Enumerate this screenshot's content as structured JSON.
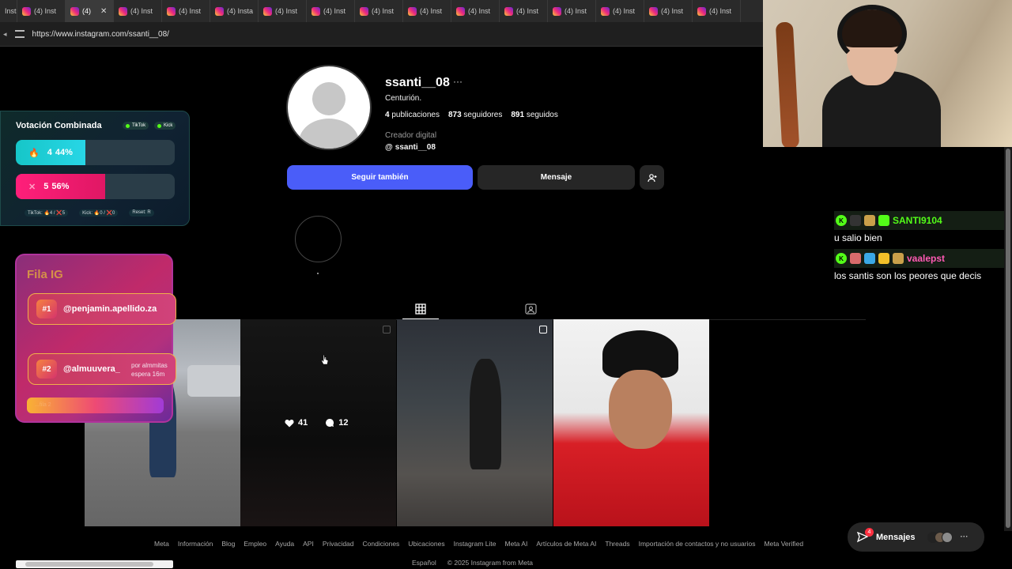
{
  "browser": {
    "tabs": [
      {
        "label": "Insta",
        "active": false
      },
      {
        "label": "(4) Inst",
        "active": false
      },
      {
        "label": "(4)",
        "active": true
      },
      {
        "label": "(4) Inst",
        "active": false
      },
      {
        "label": "(4) Inst",
        "active": false
      },
      {
        "label": "(4) Insta",
        "active": false
      },
      {
        "label": "(4) Inst",
        "active": false
      },
      {
        "label": "(4) Inst",
        "active": false
      },
      {
        "label": "(4) Inst",
        "active": false
      },
      {
        "label": "(4) Inst",
        "active": false
      },
      {
        "label": "(4) Inst",
        "active": false
      },
      {
        "label": "(4) Inst",
        "active": false
      },
      {
        "label": "(4) Inst",
        "active": false
      },
      {
        "label": "(4) Inst",
        "active": false
      },
      {
        "label": "(4) Inst",
        "active": false
      },
      {
        "label": "(4) Inst",
        "active": false
      }
    ],
    "url": "https://www.instagram.com/ssanti__08/"
  },
  "profile": {
    "username": "ssanti__08",
    "more_icon": "···",
    "bio": "Centurión.",
    "posts": "4",
    "posts_label": "publicaciones",
    "followers": "873",
    "followers_label": "seguidores",
    "following": "891",
    "following_label": "seguidos",
    "category": "Creador digital",
    "threads_handle": "ssanti__08",
    "follow_label": "Seguir también",
    "message_label": "Mensaje",
    "add_icon": "person-add-icon",
    "accent": "#4a5df9"
  },
  "post_overlay": {
    "likes": "41",
    "comments": "12"
  },
  "footer": {
    "links": [
      "Meta",
      "Información",
      "Blog",
      "Empleo",
      "Ayuda",
      "API",
      "Privacidad",
      "Condiciones",
      "Ubicaciones",
      "Instagram Lite",
      "Meta AI",
      "Artículos de Meta AI",
      "Threads",
      "Importación de contactos y no usuarios",
      "Meta Verified"
    ],
    "language": "Español",
    "copyright": "© 2025 Instagram from Meta"
  },
  "messages": {
    "label": "Mensajes",
    "badge": "4"
  },
  "vote": {
    "title": "Votación Combinada",
    "tiktok_pill": "TikTok",
    "kick_pill": "Kick",
    "fire": {
      "count": "4",
      "percent": "44%",
      "fraction": 0.44
    },
    "x": {
      "count": "5",
      "percent": "56%",
      "fraction": 0.56
    },
    "footer_tiktok": "TikTok: 🔥4 / ❌5",
    "footer_kick": "Kick: 🔥0 / ❌0",
    "footer_reset": "Reset: R"
  },
  "fila": {
    "title": "Fila IG",
    "items": [
      {
        "rank": "#1",
        "handle": "@penjamin.apellido.za"
      },
      {
        "rank": "#2",
        "handle": "@almuuvera_"
      }
    ],
    "note_line1": "por almmitas",
    "note_line2": "espera 16m",
    "bottom": "...fila 2"
  },
  "chat": [
    {
      "user": "SANTI9104",
      "text": "u salio bien",
      "user_color": "#53fc18"
    },
    {
      "user": "vaalepst",
      "text": "los santis son los peores que decis",
      "user_color": "#ff5ab4"
    }
  ]
}
